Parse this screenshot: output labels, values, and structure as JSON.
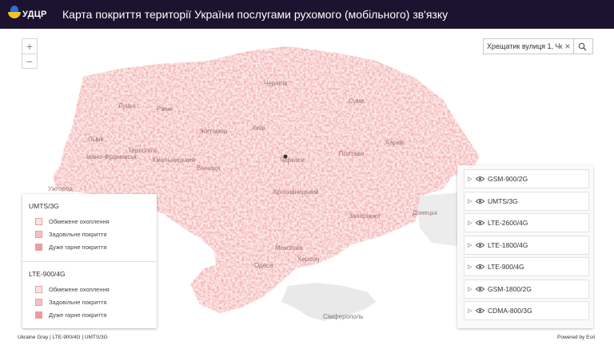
{
  "header": {
    "logo_text": "УДЦР",
    "title": "Карта покриття території України послугами рухомого (мобільного) зв'язку"
  },
  "zoom": {
    "in_label": "+",
    "out_label": "−"
  },
  "search": {
    "value": "Хрещатик вулиця 1, Чер",
    "clear_label": "×"
  },
  "map": {
    "coverage_color": "#f08f8f",
    "cities": [
      "Київ",
      "Чернігів",
      "Суми",
      "Харків",
      "Полтава",
      "Житомир",
      "Рівне",
      "Луцьк",
      "Львів",
      "Тернопіль",
      "Хмельницький",
      "Вінниця",
      "Черкаси",
      "Кропивницький",
      "Дніпро",
      "Запоріжжя",
      "Донецьк",
      "Миколаїв",
      "Херсон",
      "Одеса",
      "Сімферополь",
      "Ужгород",
      "Івано-Франківськ"
    ],
    "city_label_simferopol": "Сімферополь",
    "city_label_donetsk": "Донецьк",
    "city_label_kyiv": "Київ",
    "city_label_poltava": "Полтава",
    "city_label_kharkiv": "Харків",
    "city_label_vinnytsia": "Вінниця",
    "city_label_odesa": "Одеса",
    "city_label_zaporizhzhia": "Запоріжжя",
    "city_label_mykolaiv": "Миколаїв",
    "city_label_zhytomyr": "Житомир",
    "city_label_lviv": "Львів",
    "city_label_kropyvnytskyi": "Кропивницький",
    "city_label_cherkasy": "Черкаси",
    "city_label_chernihiv": "Чернігів",
    "city_label_lutsk": "Луцьк",
    "city_label_rivne": "Рівне",
    "city_label_kherson": "Херсон",
    "city_label_sumy": "Суми",
    "city_label_khmelnytskyi": "Хмельницький",
    "city_label_ternopil": "Тернопіль",
    "city_label_ivanofrankivsk": "Івано-Франківськ",
    "city_label_uzhhorod": "Ужгород"
  },
  "legend": {
    "sections": [
      {
        "title": "UMTS/3G",
        "items": [
          {
            "label": "Обмежене охоплення",
            "color": "#fbe3e3"
          },
          {
            "label": "Задовільне покриття",
            "color": "#f6c0c0"
          },
          {
            "label": "Дуже гарне покриття",
            "color": "#f09c9c"
          }
        ]
      },
      {
        "title": "LTE-900/4G",
        "items": [
          {
            "label": "Обмежене охоплення",
            "color": "#fbe3e3"
          },
          {
            "label": "Задовільне покриття",
            "color": "#f6c0c0"
          },
          {
            "label": "Дуже гарне покриття",
            "color": "#f09c9c"
          }
        ]
      }
    ]
  },
  "layers": [
    {
      "label": "GSM-900/2G"
    },
    {
      "label": "UMTS/3G"
    },
    {
      "label": "LTE-2600/4G"
    },
    {
      "label": "LTE-1800/4G"
    },
    {
      "label": "LTE-900/4G"
    },
    {
      "label": "GSM-1800/2G"
    },
    {
      "label": "CDMA-800/3G"
    }
  ],
  "footer": {
    "attribution": "Ukraine Gray | LTE-900/4G | UMTS/3G",
    "powered_by": "Powered by Esri"
  }
}
